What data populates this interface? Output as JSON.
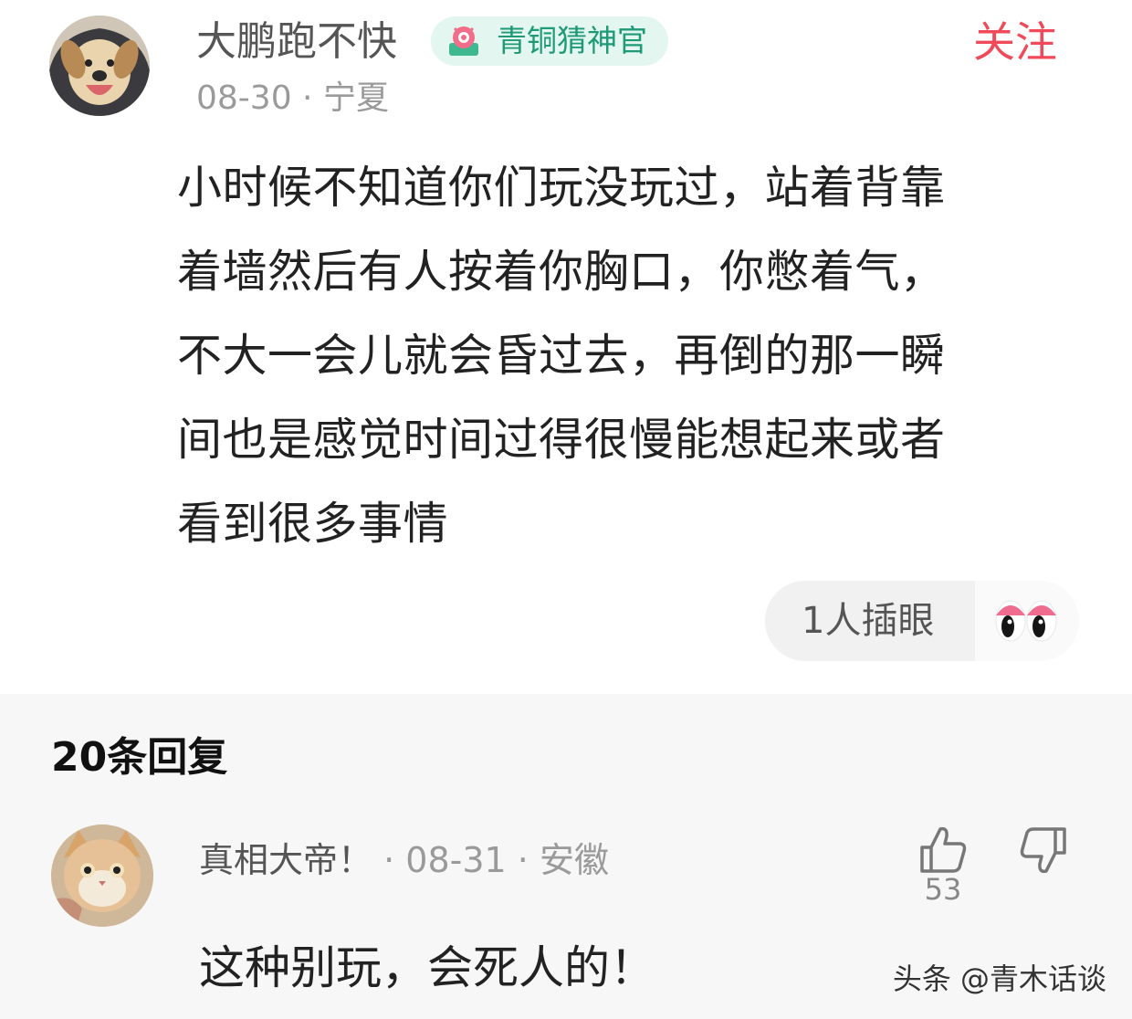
{
  "comment": {
    "username": "大鹏跑不快",
    "badge": {
      "label": "青铜猜神官",
      "color": "#1e9a76",
      "icon": "badge-emblem-icon"
    },
    "follow_label": "关注",
    "follow_color": "#f04a5a",
    "date": "08-30",
    "separator": " · ",
    "location": "宁夏",
    "body_lines": [
      "小时候不知道你们玩没玩过，站着背靠",
      "着墙然后有人按着你胸口，你憋着气，",
      "不大一会儿就会昏过去，再倒的那一瞬",
      "间也是感觉时间过得很慢能想起来或者",
      "看到很多事情"
    ],
    "reaction": {
      "label": "1人插眼",
      "icon": "eyes-icon"
    }
  },
  "replies": {
    "title": "20条回复",
    "items": [
      {
        "username": "真相大帝！",
        "sep1": " · ",
        "date": "08-31",
        "sep2": " · ",
        "location": "安徽",
        "text": "这种别玩，会死人的！",
        "likes": "53"
      }
    ]
  },
  "watermark": "头条 @青木话谈"
}
